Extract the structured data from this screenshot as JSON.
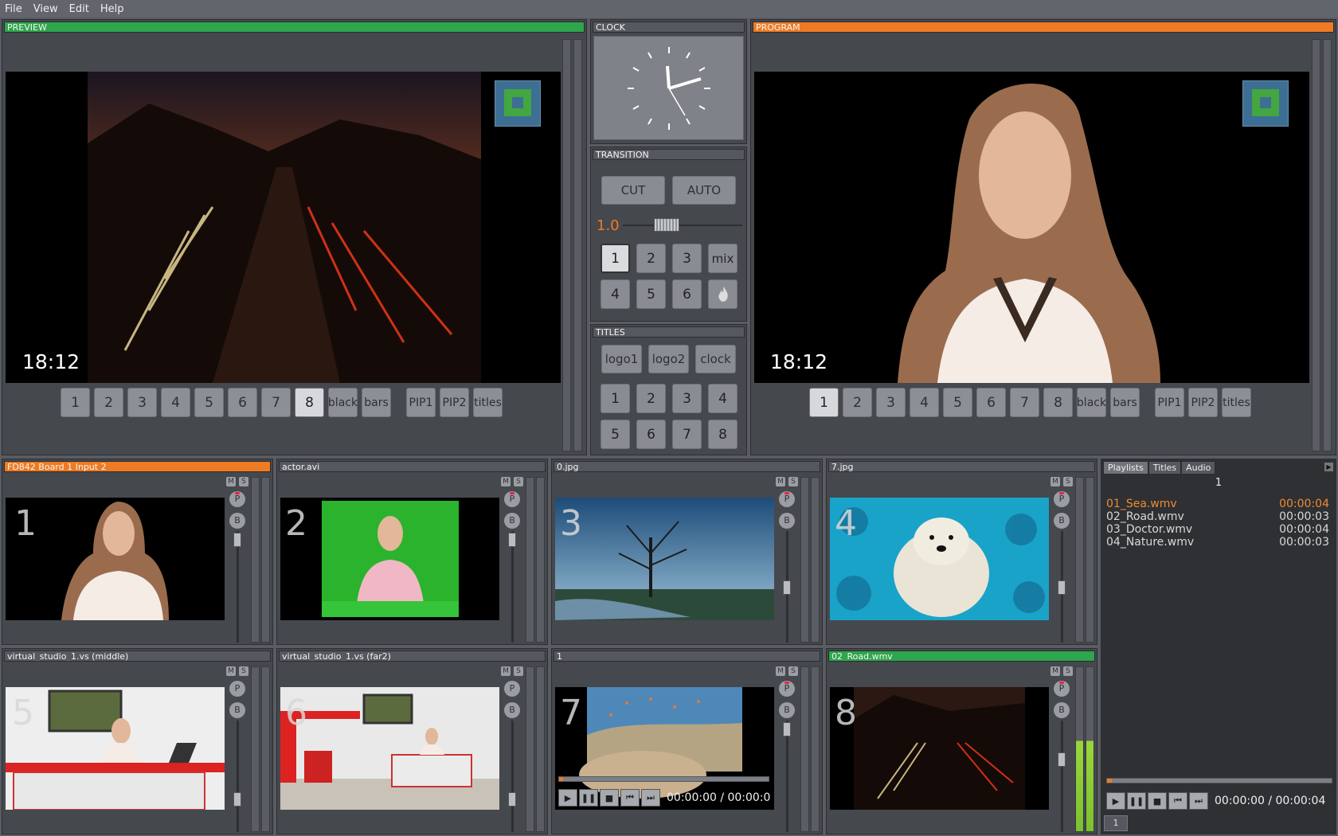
{
  "menu": [
    "File",
    "View",
    "Edit",
    "Help"
  ],
  "preview": {
    "title": "PREVIEW",
    "time": "18:12",
    "buttons": [
      "1",
      "2",
      "3",
      "4",
      "5",
      "6",
      "7",
      "8",
      "black",
      "bars"
    ],
    "extra_buttons": [
      "PIP1",
      "PIP2",
      "titles"
    ],
    "active": "8"
  },
  "program": {
    "title": "PROGRAM",
    "time": "18:12",
    "buttons": [
      "1",
      "2",
      "3",
      "4",
      "5",
      "6",
      "7",
      "8",
      "black",
      "bars"
    ],
    "extra_buttons": [
      "PIP1",
      "PIP2",
      "titles"
    ],
    "active": "1"
  },
  "clock": {
    "title": "CLOCK"
  },
  "transition": {
    "title": "TRANSITION",
    "cut_label": "CUT",
    "auto_label": "AUTO",
    "duration": "1.0",
    "effects": [
      "1",
      "2",
      "3",
      "mix",
      "4",
      "5",
      "6",
      ""
    ]
  },
  "titles_panel": {
    "title": "TITLES",
    "buttons": [
      "logo1",
      "logo2",
      "clock"
    ],
    "numbers": [
      "1",
      "2",
      "3",
      "4",
      "5",
      "6",
      "7",
      "8"
    ]
  },
  "inputs": [
    {
      "title": "FD842 Board 1 Input 2",
      "number": "1",
      "status": "orange",
      "icons": [
        "M",
        "S",
        "P",
        "B"
      ]
    },
    {
      "title": "actor.avi",
      "number": "2",
      "status": "normal",
      "icons": [
        "M",
        "S",
        "P",
        "B"
      ]
    },
    {
      "title": "0.jpg",
      "number": "3",
      "status": "normal",
      "icons": [
        "M",
        "S",
        "P",
        "B"
      ]
    },
    {
      "title": "7.jpg",
      "number": "4",
      "status": "normal",
      "icons": [
        "M",
        "S",
        "P",
        "B"
      ]
    },
    {
      "title": "virtual_studio_1.vs (middle)",
      "number": "5",
      "status": "normal",
      "icons": [
        "M",
        "S",
        "P",
        "B"
      ]
    },
    {
      "title": "virtual_studio_1.vs (far2)",
      "number": "6",
      "status": "normal",
      "icons": [
        "M",
        "S",
        "P",
        "B"
      ]
    },
    {
      "title": "1",
      "number": "7",
      "status": "normal",
      "icons": [
        "M",
        "S",
        "P",
        "B"
      ],
      "timecode": "00:00:00 / 00:00:0"
    },
    {
      "title": "02_Road.wmv",
      "number": "8",
      "status": "green",
      "icons": [
        "M",
        "S",
        "P",
        "B"
      ]
    }
  ],
  "playlist": {
    "tabs": [
      "Playlists",
      "Titles",
      "Audio"
    ],
    "active_tab": "Playlists",
    "header": "1",
    "items": [
      {
        "name": "01_Sea.wmv",
        "duration": "00:00:04",
        "current": true
      },
      {
        "name": "02_Road.wmv",
        "duration": "00:00:03",
        "current": false
      },
      {
        "name": "03_Doctor.wmv",
        "duration": "00:00:04",
        "current": false
      },
      {
        "name": "04_Nature.wmv",
        "duration": "00:00:03",
        "current": false
      }
    ],
    "timecode": "00:00:00 / 00:00:04",
    "page": "1"
  },
  "colors": {
    "preview": "#2ea64b",
    "program": "#ee7b24",
    "accent": "#ee7b24"
  }
}
